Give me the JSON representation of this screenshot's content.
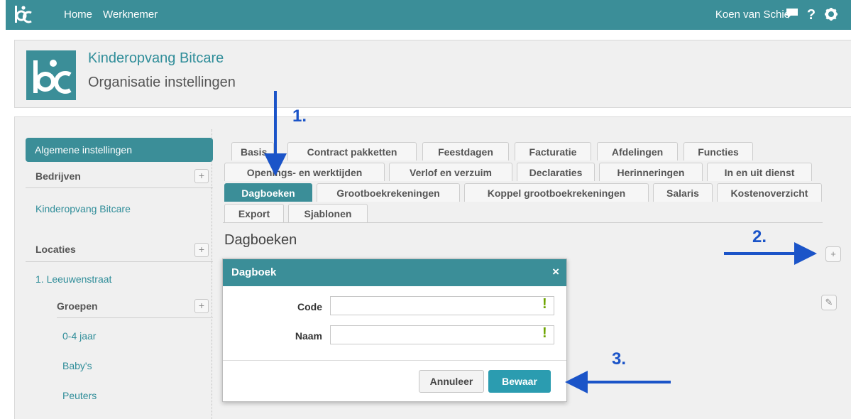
{
  "topbar": {
    "nav": [
      "Home",
      "Werknemer"
    ],
    "user": "Koen van Schie",
    "icons": [
      "chat-icon",
      "help-icon",
      "gear-icon"
    ],
    "help_glyph": "?"
  },
  "header": {
    "org_name": "Kinderopvang Bitcare",
    "subtitle": "Organisatie instellingen"
  },
  "sidebar": {
    "active_item": "Algemene instellingen",
    "bedrijven_label": "Bedrijven",
    "company": "Kinderopvang Bitcare",
    "locaties_label": "Locaties",
    "location": "1. Leeuwenstraat",
    "groepen_label": "Groepen",
    "groups": [
      "0-4 jaar",
      "Baby's",
      "Peuters"
    ],
    "plus_glyph": "+"
  },
  "tabs": {
    "row1": [
      "Basis",
      "Contract pakketten",
      "Feestdagen",
      "Facturatie",
      "Afdelingen",
      "Functies"
    ],
    "row2": [
      "Openings- en werktijden",
      "Verlof en verzuim",
      "Declaraties",
      "Herinneringen",
      "In en uit dienst"
    ],
    "row3": [
      "Dagboeken",
      "Grootboekrekeningen",
      "Koppel grootboekrekeningen",
      "Salaris",
      "Kostenoverzicht"
    ],
    "row4": [
      "Export",
      "Sjablonen"
    ],
    "active": "Dagboeken"
  },
  "main": {
    "section_title": "Dagboeken",
    "add_glyph": "+",
    "edit_glyph": "✎"
  },
  "dialog": {
    "title": "Dagboek",
    "close_glyph": "×",
    "code_label": "Code",
    "code_value": "",
    "naam_label": "Naam",
    "naam_value": "",
    "required_glyph": "!",
    "cancel_label": "Annuleer",
    "save_label": "Bewaar"
  },
  "annotations": {
    "step1": "1.",
    "step2": "2.",
    "step3": "3.",
    "arrow_color": "#1b54c8"
  },
  "colors": {
    "primary": "#3b8e98",
    "link": "#2f8d99",
    "save_button": "#2b9cb0",
    "required": "#6ea400"
  }
}
